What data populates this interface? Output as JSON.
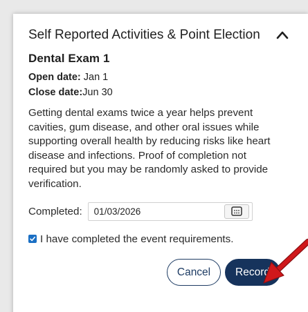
{
  "section": {
    "title": "Self Reported Activities & Point Election",
    "toggle_icon": "chevron-up-icon"
  },
  "activity": {
    "title": "Dental Exam 1",
    "open_label": "Open date:",
    "open_value": "Jan 1",
    "close_label": "Close date:",
    "close_value": "Jun 30",
    "description": "Getting dental exams twice a year helps prevent cavities, gum disease, and other oral issues while supporting overall health by reducing risks like heart disease and infections. Proof of completion not required but you may be randomly asked to provide verification.",
    "completed_label": "Completed:",
    "completed_value": "01/03/2026",
    "calendar_icon": "calendar-icon",
    "attest_label": "I have completed the event requirements.",
    "attest_checked": true
  },
  "actions": {
    "cancel_label": "Cancel",
    "record_label": "Record"
  },
  "colors": {
    "primary": "#16335c",
    "checkbox": "#1a6fc4",
    "annotation_arrow": "#d0181b"
  }
}
